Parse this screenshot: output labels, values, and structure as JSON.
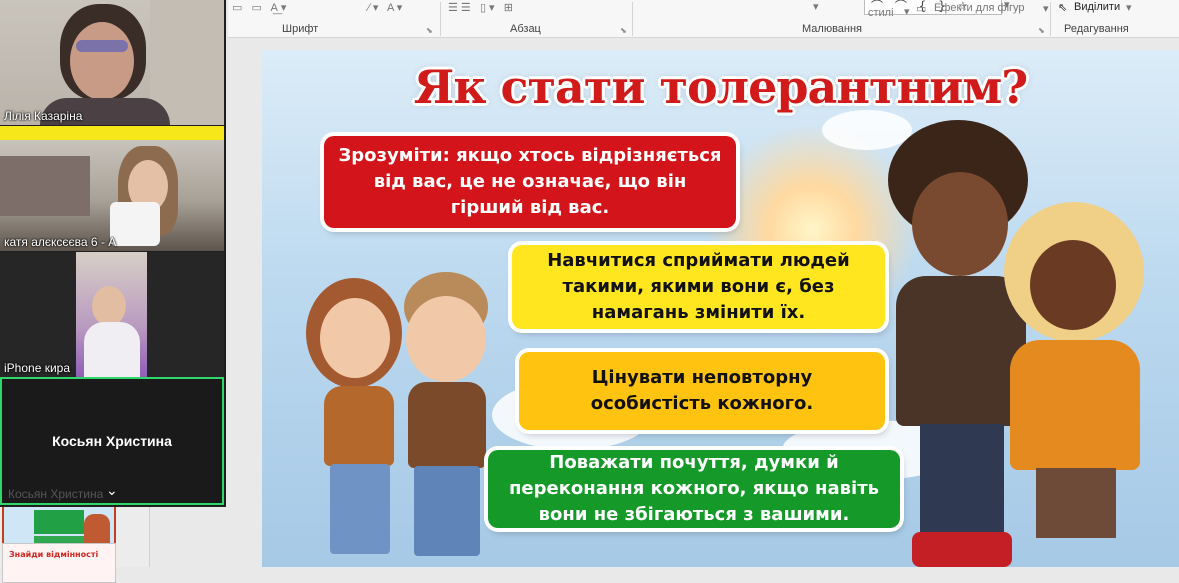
{
  "ribbon": {
    "groups": [
      "Шрифт",
      "Абзац",
      "Малювання",
      "Редагування"
    ],
    "styles_label": "стилі",
    "shape_effects_label": "Ефекти для фігур",
    "select_label": "Виділити",
    "shapes_row": "⌒ ⌒ { } ☆"
  },
  "thumbnails": {
    "slide2_title": "Знайди відмінності"
  },
  "slide": {
    "title": "Як стати толерантним?",
    "bubbles": [
      "Зрозуміти: якщо хтось відрізняється від вас, це не означає, що він гірший від вас.",
      "Навчитися сприймати людей такими, якими вони є, без намагань змінити їх.",
      "Цінувати неповторну особистість кожного.",
      "Поважати почуття, думки й переконання кожного, якщо навіть вони не збігаються з вашими."
    ],
    "colors": {
      "red": "#d3141a",
      "yellow": "#ffe61f",
      "amber": "#ffc310",
      "green": "#159a2a",
      "title": "#d11a1a"
    }
  },
  "participants": [
    {
      "name": "Лілія Казаріна"
    },
    {
      "name": "катя алєксєєва 6 - А"
    },
    {
      "name": "iPhone кира"
    },
    {
      "name": "Косьян Христина",
      "ghost_name": "Косьян Христина",
      "active": true
    }
  ],
  "icons": [
    "chevron-down-icon",
    "dialog-launcher-icon",
    "select-cursor-icon"
  ]
}
